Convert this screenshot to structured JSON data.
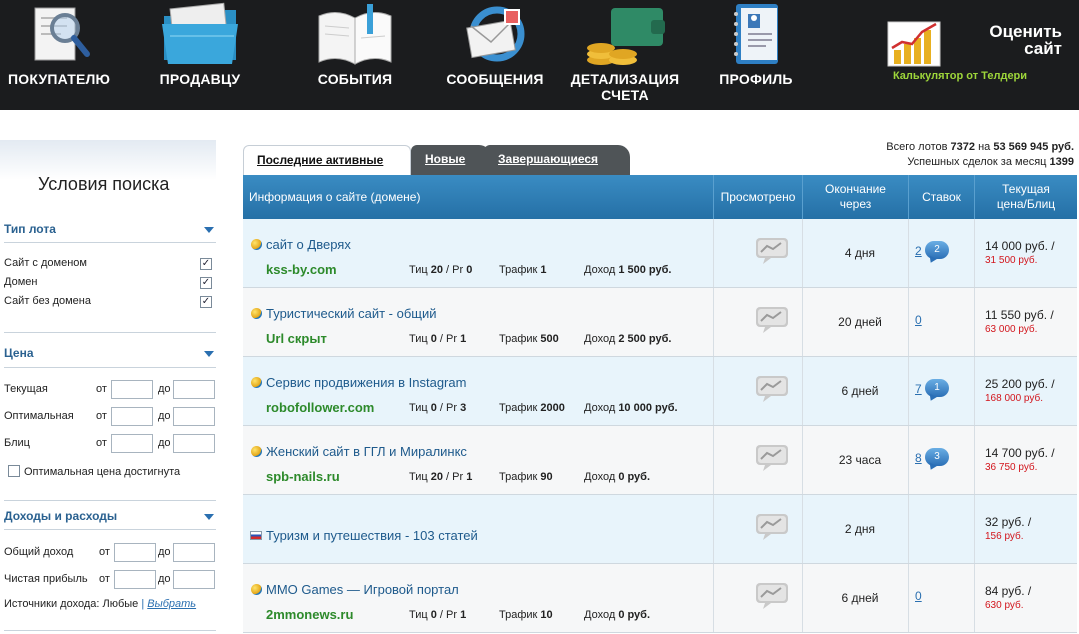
{
  "nav": {
    "items": [
      {
        "label": "ПОКУПАТЕЛЮ",
        "icon": "document-magnifier-icon"
      },
      {
        "label": "ПРОДАВЦУ",
        "icon": "folder-icon"
      },
      {
        "label": "СОБЫТИЯ",
        "icon": "book-icon"
      },
      {
        "label": "СООБЩЕНИЯ",
        "icon": "mail-envelope-icon"
      },
      {
        "label": "ДЕТАЛИЗАЦИЯ",
        "label2": "СЧЕТА",
        "icon": "wallet-coins-icon"
      },
      {
        "label": "ПРОФИЛЬ",
        "icon": "address-book-icon"
      }
    ],
    "rate": {
      "title1": "Оценить",
      "title2": "сайт",
      "subtitle": "Калькулятор от Телдери",
      "icon": "growth-chart-icon"
    }
  },
  "sidebar": {
    "title": "Условия поиска",
    "lot_type": {
      "header": "Тип лота",
      "options": [
        {
          "label": "Сайт с доменом",
          "checked": true
        },
        {
          "label": "Домен",
          "checked": true
        },
        {
          "label": "Сайт без домена",
          "checked": true
        }
      ]
    },
    "price": {
      "header": "Цена",
      "from": "от",
      "to": "до",
      "rows": [
        "Текущая",
        "Оптимальная",
        "Блиц"
      ],
      "optimal_reached": "Оптимальная цена достигнута"
    },
    "income": {
      "header": "Доходы и расходы",
      "from": "от",
      "to": "до",
      "rows": [
        "Общий доход",
        "Чистая прибыль"
      ],
      "sources_label": "Источники дохода: Любые",
      "sources_sep": "|",
      "sources_link": "Выбрать"
    }
  },
  "tabs": {
    "active": "Последние активные",
    "new": "Новые",
    "ending": "Завершающиеся"
  },
  "stats": {
    "line1_prefix": "Всего лотов",
    "lots": "7372",
    "line1_mid": "на",
    "amount": "53 569 945 руб.",
    "line2_prefix": "Успешных сделок за месяц",
    "deals": "1399"
  },
  "table": {
    "headers": {
      "info": "Информация о сайте (домене)",
      "viewed": "Просмотрено",
      "ends1": "Окончание",
      "ends2": "через",
      "bids": "Ставок",
      "price1": "Текущая",
      "price2": "цена/Блиц"
    },
    "rows": [
      {
        "title": "сайт о Дверях",
        "domain": "kss-by.com",
        "tic": "20",
        "pr": "0",
        "traffic": "1",
        "income": "1 500 руб.",
        "ends": "4 дня",
        "bids": "2",
        "new_bids": "2",
        "price": "14 000 руб. /",
        "blitz": "31 500 руб."
      },
      {
        "title": "Туристический сайт - общий",
        "domain": "Url скрыт",
        "tic": "0",
        "pr": "1",
        "traffic": "500",
        "income": "2 500 руб.",
        "ends": "20 дней",
        "bids": "0",
        "new_bids": "",
        "price": "11 550 руб. /",
        "blitz": "63 000 руб."
      },
      {
        "title": "Сервис продвижения в Instagram",
        "domain": "robofollower.com",
        "tic": "0",
        "pr": "3",
        "traffic": "2000",
        "income": "10 000 руб.",
        "ends": "6 дней",
        "bids": "7",
        "new_bids": "1",
        "price": "25 200 руб. /",
        "blitz": "168 000 руб."
      },
      {
        "title": "Женский сайт в ГГЛ и Миралинкс",
        "domain": "spb-nails.ru",
        "tic": "20",
        "pr": "1",
        "traffic": "90",
        "income": "0 руб.",
        "ends": "23 часа",
        "bids": "8",
        "new_bids": "3",
        "price": "14 700 руб. /",
        "blitz": "36 750 руб."
      },
      {
        "title": "Туризм и путешествия - 103 статей",
        "domain": "",
        "ends": "2 дня",
        "bids": "",
        "new_bids": "",
        "price": "32 руб. /",
        "blitz": "156 руб."
      },
      {
        "title": "MMO Games — Игровой портал",
        "domain": "2mmonews.ru",
        "tic": "0",
        "pr": "1",
        "traffic": "10",
        "income": "0 руб.",
        "ends": "6 дней",
        "bids": "0",
        "new_bids": "",
        "price": "84 руб. /",
        "blitz": "630 руб."
      }
    ],
    "labels": {
      "tic": "Тиц",
      "pr": "Pr",
      "traffic": "Трафик",
      "income": "Доход"
    }
  }
}
